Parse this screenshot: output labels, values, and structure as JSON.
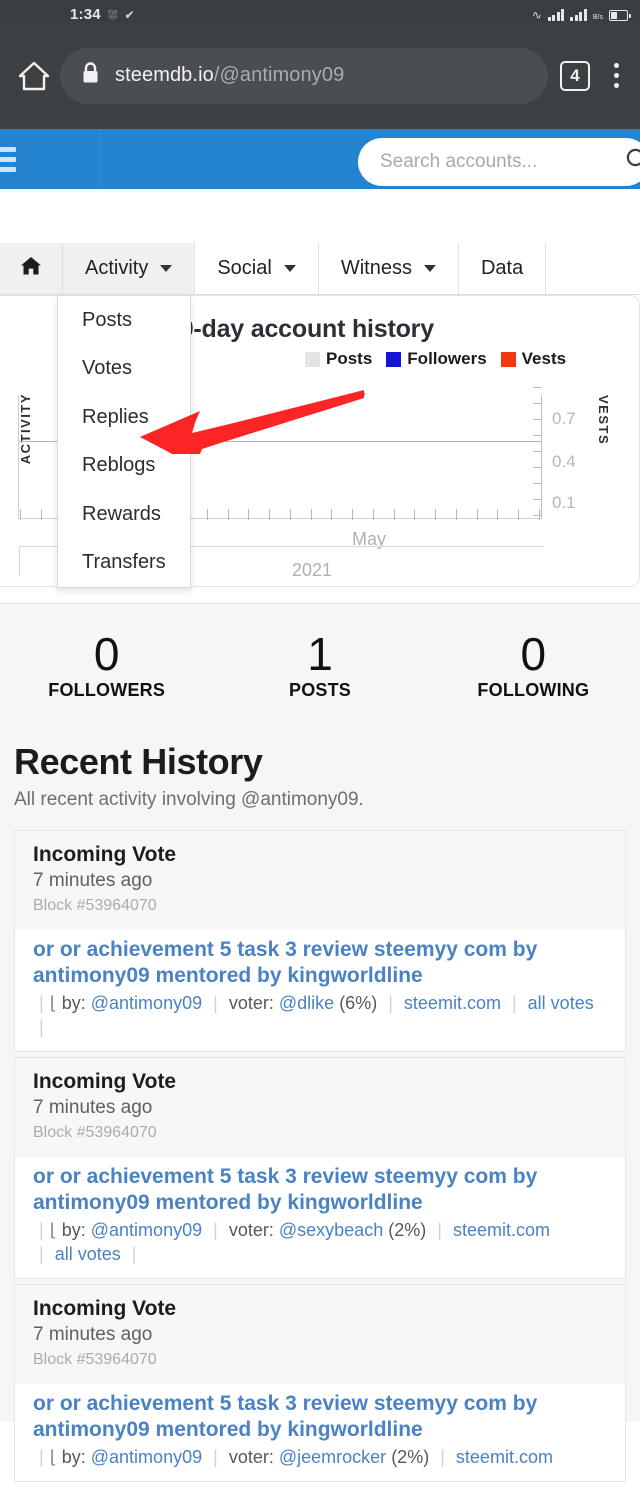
{
  "status_bar": {
    "time": "1:34",
    "icons": [
      "vibrate-icon",
      "shield-icon",
      "pulse-icon",
      "signal-bars-icon",
      "signal-bars-icon",
      "data-rate-icon",
      "battery-icon"
    ],
    "data_rate_label": "B/s"
  },
  "browser": {
    "home_icon": "home-icon",
    "lock_icon": "lock-icon",
    "url_domain": "steemdb.io",
    "url_path": "/@antimony09",
    "tab_count": "4",
    "menu_icon": "kebab-menu-icon"
  },
  "site_nav": {
    "menu_icon": "hamburger-icon",
    "search_placeholder": "Search accounts...",
    "search_value": "",
    "search_icon": "magnifier-icon",
    "accent_color": "#2484d0"
  },
  "tabs": [
    {
      "label": "",
      "icon": "home-icon",
      "has_caret": false,
      "active": true
    },
    {
      "label": "Activity",
      "has_caret": true,
      "active": true
    },
    {
      "label": "Social",
      "has_caret": true,
      "active": false
    },
    {
      "label": "Witness",
      "has_caret": true,
      "active": false
    },
    {
      "label": "Data",
      "has_caret": false,
      "active": false
    }
  ],
  "dropdown": {
    "open_for": "Activity",
    "items": [
      "Posts",
      "Votes",
      "Replies",
      "Reblogs",
      "Rewards",
      "Transfers"
    ],
    "highlighted": "Replies"
  },
  "annotation": {
    "shape": "arrow-left-icon",
    "color": "#fb2525",
    "points_at": "Replies"
  },
  "chart_data": {
    "type": "line",
    "title": "30-day account history",
    "legend": [
      {
        "name": "Posts",
        "color": "#e3e3e3"
      },
      {
        "name": "Followers",
        "color": "#1414d2"
      },
      {
        "name": "Vests",
        "color": "#f4350f"
      }
    ],
    "legend_position": "top-center",
    "grid": true,
    "xlabel": "",
    "x_tick_labels": [
      "May"
    ],
    "x_period_label": "2021",
    "left_axis": {
      "name": "ACTIVITY",
      "ticks": []
    },
    "right_axis": {
      "name": "VESTS",
      "ticks": [
        "0.1",
        "0.4",
        "0.7"
      ],
      "ylim": [
        0,
        0.85
      ]
    },
    "series": [
      {
        "name": "Posts",
        "values": []
      },
      {
        "name": "Followers",
        "values": []
      },
      {
        "name": "Vests",
        "values": []
      }
    ]
  },
  "stats": [
    {
      "value": "0",
      "label": "FOLLOWERS"
    },
    {
      "value": "1",
      "label": "POSTS"
    },
    {
      "value": "0",
      "label": "FOLLOWING"
    }
  ],
  "recent_history": {
    "title": "Recent History",
    "subtitle": "All recent activity involving @antimony09.",
    "cards": [
      {
        "kind": "Incoming Vote",
        "when": "7 minutes ago",
        "block": "Block #53964070",
        "post_title": "or or achievement 5 task 3 review steemyy com by antimony09 mentored by kingworldline",
        "by_label": "by:",
        "by_user": "@antimony09",
        "voter_label": "voter:",
        "voter_user": "@dlike",
        "weight": "(6%)",
        "source_link": "steemit.com",
        "votes_link": "all votes"
      },
      {
        "kind": "Incoming Vote",
        "when": "7 minutes ago",
        "block": "Block #53964070",
        "post_title": "or or achievement 5 task 3 review steemyy com by antimony09 mentored by kingworldline",
        "by_label": "by:",
        "by_user": "@antimony09",
        "voter_label": "voter:",
        "voter_user": "@sexybeach",
        "weight": "(2%)",
        "source_link": "steemit.com",
        "votes_link": "all votes"
      },
      {
        "kind": "Incoming Vote",
        "when": "7 minutes ago",
        "block": "Block #53964070",
        "post_title": "or or achievement 5 task 3 review steemyy com by antimony09 mentored by kingworldline",
        "by_label": "by:",
        "by_user": "@antimony09",
        "voter_label": "voter:",
        "voter_user": "@jeemrocker",
        "weight": "(2%)",
        "source_link": "steemit.com",
        "votes_link": ""
      }
    ]
  }
}
